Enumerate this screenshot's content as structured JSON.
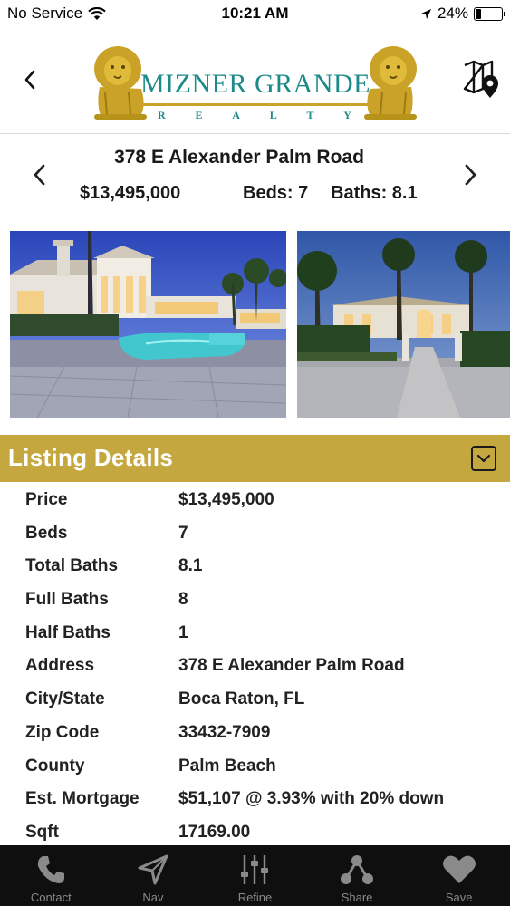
{
  "status_bar": {
    "carrier": "No Service",
    "time": "10:21 AM",
    "battery": "24%",
    "battery_level": 0.24
  },
  "header": {
    "logo_title": "MIZNER GRANDE",
    "logo_subtitle": [
      "R",
      "E",
      "A",
      "L",
      "T",
      "Y"
    ]
  },
  "listing": {
    "address": "378 E Alexander Palm Road",
    "price": "$13,495,000",
    "beds": "Beds: 7",
    "baths": "Baths: 8.1"
  },
  "details": {
    "title": "Listing Details",
    "rows": [
      {
        "label": "Price",
        "value": "$13,495,000"
      },
      {
        "label": "Beds",
        "value": "7"
      },
      {
        "label": "Total Baths",
        "value": "8.1"
      },
      {
        "label": "Full Baths",
        "value": "8"
      },
      {
        "label": "Half Baths",
        "value": "1"
      },
      {
        "label": "Address",
        "value": "378 E Alexander Palm Road"
      },
      {
        "label": "City/State",
        "value": "Boca Raton, FL"
      },
      {
        "label": "Zip Code",
        "value": "33432-7909"
      },
      {
        "label": "County",
        "value": "Palm Beach"
      },
      {
        "label": "Est. Mortgage",
        "value": "$51,107 @ 3.93% with 20% down"
      },
      {
        "label": "Sqft",
        "value": "17169.00"
      }
    ]
  },
  "tabs": [
    {
      "label": "Contact",
      "icon": "phone-icon"
    },
    {
      "label": "Nav",
      "icon": "navigation-arrow-icon"
    },
    {
      "label": "Refine",
      "icon": "sliders-icon"
    },
    {
      "label": "Share",
      "icon": "share-icon"
    },
    {
      "label": "Save",
      "icon": "heart-icon"
    }
  ],
  "colors": {
    "accent_gold": "#c5a73f",
    "logo_teal": "#1d8a8a",
    "tab_bar": "#0f0f0f",
    "tab_inactive": "#8a8a8a"
  }
}
